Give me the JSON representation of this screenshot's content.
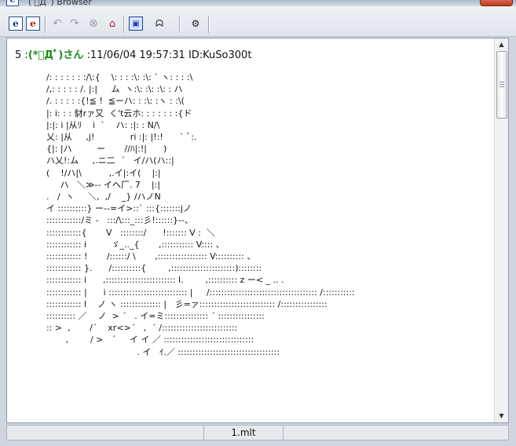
{
  "window": {
    "title": "( ﾟДﾟ) Browser",
    "icon_letter": "e"
  },
  "toolbar": {
    "btn_open": "e",
    "btn_open2": "e",
    "btn_back": "↶",
    "btn_forward": "↷",
    "btn_stop": "⊗",
    "btn_home": "⌂",
    "btn_thread": "▣",
    "btn_face": "ᗣ",
    "btn_settings": "⚙"
  },
  "post": {
    "number": "5",
    "separator": ":",
    "name": "(*ﾟДﾟ)さん",
    "datetime": ":11/06/04 19:57:31",
    "id": "ID:KuSo300t",
    "art": "/: : : : : : :/\\:{    \\: : : :\\: :\\: ` ヽ: : : :\\\n/,: : : : : /. |:|     ム  ヽ:\\: :\\: :\\: : ハ\n/. : : : : :{!≦ !  ≦ーハ: : :\\: :ヽ : :\\(\n|: i: : : 豺rァ又  く't云ホ: : : : : : :{ド\n|:|: i |从ﾘ    i  `    ハ: :|: : N/\\\n乂: |从     ,j!             ri :|: |!:!      ` ﾞ:.\n{|: |ハ         ー       //ﾊ|:!|      )\nハ乂!:ム     ,.ニ二  ´   イ/ハ(ハ::|\n(    !/ハ|\\          ,.イ|:イ(    |:|\n     ハ   ＼≫-- イヘ厂. 7    |:|\n.   /  ヽ     ＼,  ,/    _} /ハノN\nイ ::::::::::} ー--=イ>::` :::{:::::::jノ\n::::::::::::/ミ ‐   :::/\\:::_:::彡!::::::}--、\n::::::::::::{       V   ::::::::/      !::::::: V :  ＼\n:::::::::::: i         ゞ_.._{       ,::::::::::: V:::: 、\n:::::::::::: !       /::::::/ \\       ,::::::::::::::::: V:::::::::: 、\n:::::::::::: }.      /::::::::::{        ,::::::::::::::::::::::)::::::::\n:::::::::::: i      ,:::::::::::::::::::::::: l.        ,:::::::::: z ー< _ .. .\n:::::::::::: |      i ::::::::::::::::::::::::::: |     /::::::::::::::::::::::::::::::::::::: /:::::::::::\n:::::::::::: l    ノ ヽ :::::::::::::: |   彡=ァ:::::::::::::::::::::::::: /::::::::::::::::\n:::::::::: ／    ノ  > ´   . イ=ミ::::::::::::::: ´ ::::::::::::::::\n:: >  ,       /´    xr<>´   ,  ´ /::::::::::::::::::::::::::\n       ,        / >   ´     イ イ ／ :::::::::::::::::::::::::::::::\n                                 . イ   ｲ.／ :::::::::::::::::::::::::::::::::::"
  },
  "status": {
    "filename": "1.mlt"
  }
}
